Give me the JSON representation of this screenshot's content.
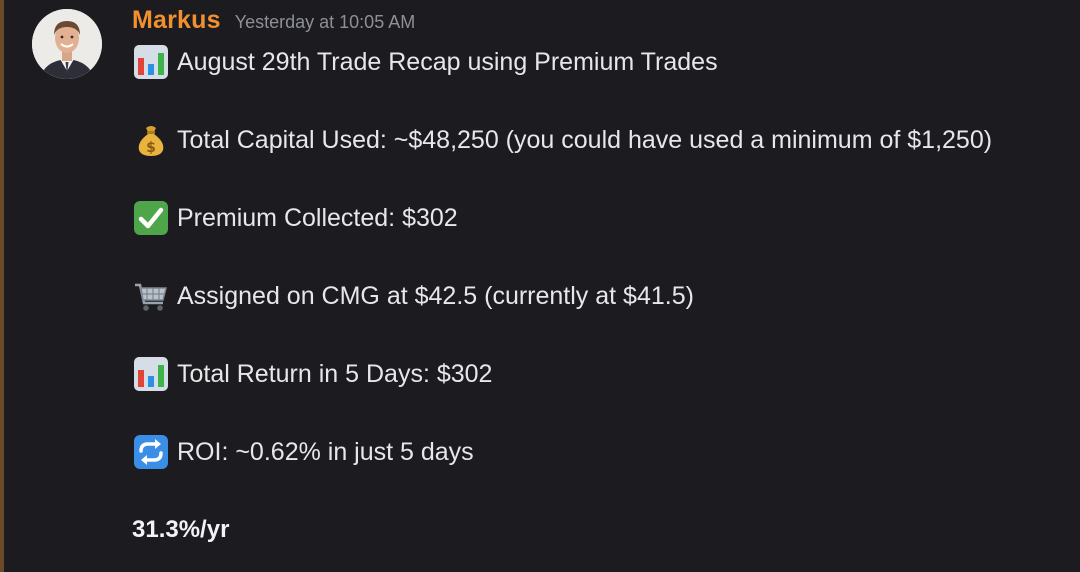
{
  "message": {
    "username": "Markus",
    "timestamp": "Yesterday at 10:05 AM",
    "lines": [
      {
        "icon": "bar-chart-emoji",
        "text": "August 29th Trade Recap using Premium Trades"
      },
      {
        "icon": "money-bag-emoji",
        "text": "Total Capital Used: ~$48,250 (you could have used a minimum of $1,250)"
      },
      {
        "icon": "check-mark-emoji",
        "text": "Premium Collected: $302"
      },
      {
        "icon": "shopping-cart-emoji",
        "text": "Assigned on CMG at $42.5 (currently at $41.5)"
      },
      {
        "icon": "bar-chart-emoji",
        "text": "Total Return in 5 Days: $302"
      },
      {
        "icon": "repeat-arrows-emoji",
        "text": "ROI: ~0.62% in just 5 days"
      }
    ],
    "highlight": "31.3%/yr"
  },
  "colors": {
    "background": "#1c1b1f",
    "username": "#f0902f",
    "timestamp": "#8d9097",
    "text": "#e6e7e9"
  }
}
